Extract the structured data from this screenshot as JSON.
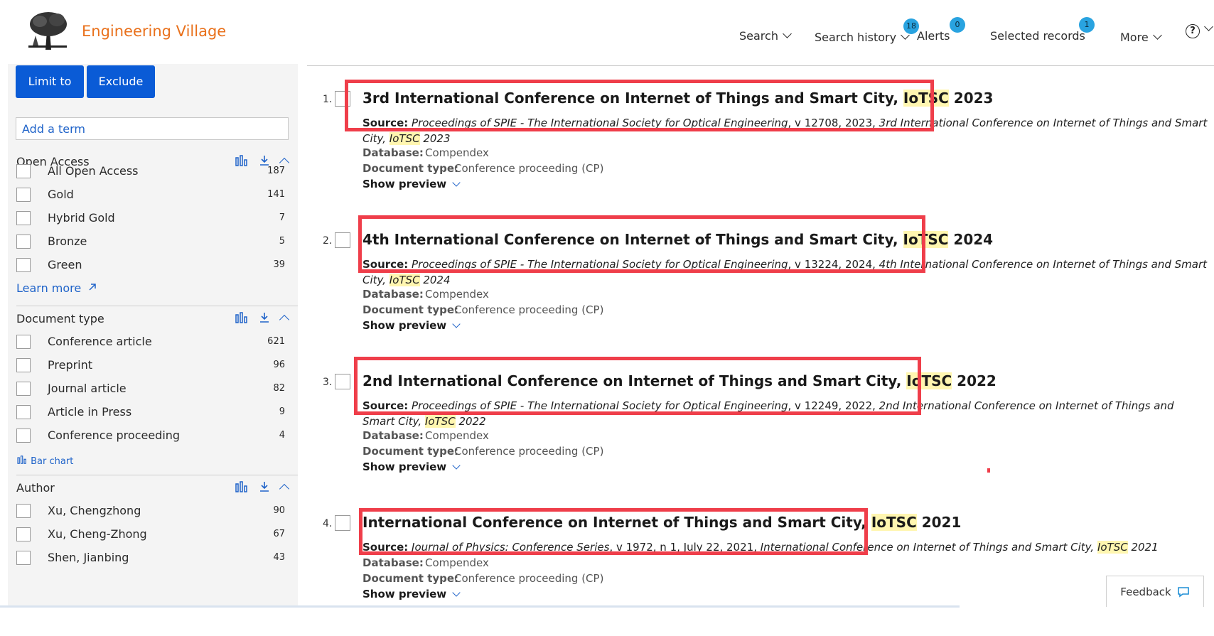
{
  "header": {
    "brand": "Engineering Village",
    "nav": {
      "search": "Search",
      "history": "Search history",
      "history_badge": "18",
      "alerts": "Alerts",
      "alerts_badge": "0",
      "selected": "Selected records",
      "selected_badge": "1",
      "more": "More",
      "help": "?"
    }
  },
  "sidebar": {
    "limit_label": "Limit to",
    "exclude_label": "Exclude",
    "term_placeholder": "Add a term",
    "open_access": {
      "title": "Open Access",
      "items": [
        {
          "label": "All Open Access",
          "count": "187"
        },
        {
          "label": "Gold",
          "count": "141"
        },
        {
          "label": "Hybrid Gold",
          "count": "7"
        },
        {
          "label": "Bronze",
          "count": "5"
        },
        {
          "label": "Green",
          "count": "39"
        }
      ],
      "learn_more": "Learn more"
    },
    "document_type": {
      "title": "Document type",
      "items": [
        {
          "label": "Conference article",
          "count": "621"
        },
        {
          "label": "Preprint",
          "count": "96"
        },
        {
          "label": "Journal article",
          "count": "82"
        },
        {
          "label": "Article in Press",
          "count": "9"
        },
        {
          "label": "Conference proceeding",
          "count": "4"
        }
      ],
      "bar_chart": "Bar chart"
    },
    "author": {
      "title": "Author",
      "items": [
        {
          "label": "Xu, Chengzhong",
          "count": "90"
        },
        {
          "label": "Xu, Cheng-Zhong",
          "count": "67"
        },
        {
          "label": "Shen, Jianbing",
          "count": "43"
        }
      ]
    }
  },
  "results": {
    "source_label": "Source:",
    "database_label": "Database:",
    "doctype_label": "Document type:",
    "preview_label": "Show preview",
    "items": [
      {
        "num": "1.",
        "title_pre": "3rd International Conference on Internet of Things and Smart City, ",
        "title_hl": "IoTSC",
        "title_post": " 2023",
        "source_journal": "Proceedings of SPIE - The International Society for Optical Engineering",
        "source_mid": ", v 12708, 2023, ",
        "source_conf": "3rd International Conference on Internet of Things and Smart City, ",
        "source_hl": "IoTSC",
        "source_tail": " 2023",
        "database": "Compendex",
        "doctype": "Conference proceeding (CP)"
      },
      {
        "num": "2.",
        "title_pre": "4th International Conference on Internet of Things and Smart City, ",
        "title_hl": "IoTSC",
        "title_post": " 2024",
        "source_journal": "Proceedings of SPIE - The International Society for Optical Engineering",
        "source_mid": ", v 13224, 2024, ",
        "source_conf": "4th International Conference on Internet of Things and Smart City, ",
        "source_hl": "IoTSC",
        "source_tail": " 2024",
        "database": "Compendex",
        "doctype": "Conference proceeding (CP)"
      },
      {
        "num": "3.",
        "title_pre": "2nd International Conference on Internet of Things and Smart City, ",
        "title_hl": "IoTSC",
        "title_post": " 2022",
        "source_journal": "Proceedings of SPIE - The International Society for Optical Engineering",
        "source_mid": ", v 12249, 2022, ",
        "source_conf": "2nd International Conference on Internet of Things and Smart City, ",
        "source_hl": "IoTSC",
        "source_tail": " 2022",
        "database": "Compendex",
        "doctype": "Conference proceeding (CP)"
      },
      {
        "num": "4.",
        "title_pre": "International Conference on Internet of Things and Smart City, ",
        "title_hl": "IoTSC",
        "title_post": " 2021",
        "source_journal": "Journal of Physics: Conference Series",
        "source_mid": ", v 1972, n 1, July 22, 2021, ",
        "source_conf": "International Conference on Internet of Things and Smart City, ",
        "source_hl": "IoTSC",
        "source_tail": " 2021",
        "database": "Compendex",
        "doctype": "Conference proceeding (CP)"
      }
    ]
  },
  "feedback_label": "Feedback",
  "colors": {
    "brand": "#e9711c",
    "primary": "#0a5bd6",
    "badge": "#29a3e0",
    "highlight": "#fff6b0",
    "annotation": "#ef3e4a"
  }
}
